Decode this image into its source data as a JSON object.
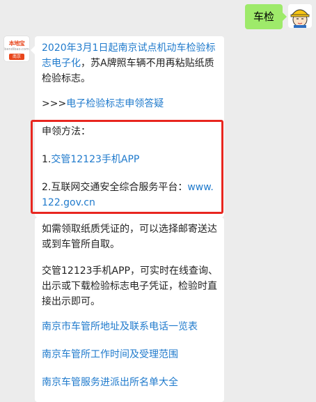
{
  "user": {
    "message": "车检",
    "avatar_icon": "construction-worker-avatar"
  },
  "bot": {
    "avatar_brand": "本地宝",
    "avatar_brand_sub": "bendibao.com",
    "avatar_city": "南京"
  },
  "message1": {
    "intro_link": "2020年3月1日起南京试点机动车检验标志电子化",
    "intro_text": "，苏A牌照车辆不用再粘贴纸质检验标志。",
    "faq_prefix": ">>>",
    "faq_link": "电子检验标志申领答疑",
    "method_title": "申领方法：",
    "method1_prefix": "1.",
    "method1_link": "交管12123手机APP",
    "method2_text": "2.互联网交通安全综合服务平台：",
    "method2_link": "www.122.gov.cn"
  },
  "message2": {
    "paper_note": "如需领取纸质凭证的，可以选择邮寄送达或到车管所自取。",
    "app_note": "交管12123手机APP，可实时在线查询、出示或下载检验标志电子凭证，检验时直接出示即可。",
    "links": [
      "南京市车管所地址及联系电话一览表",
      "南京车管所工作时间及受理范围",
      "南京车管服务进派出所名单大全"
    ]
  },
  "colors": {
    "link": "#1f7acc",
    "highlight": "#e8261f",
    "user_bubble": "#9eea6a"
  }
}
